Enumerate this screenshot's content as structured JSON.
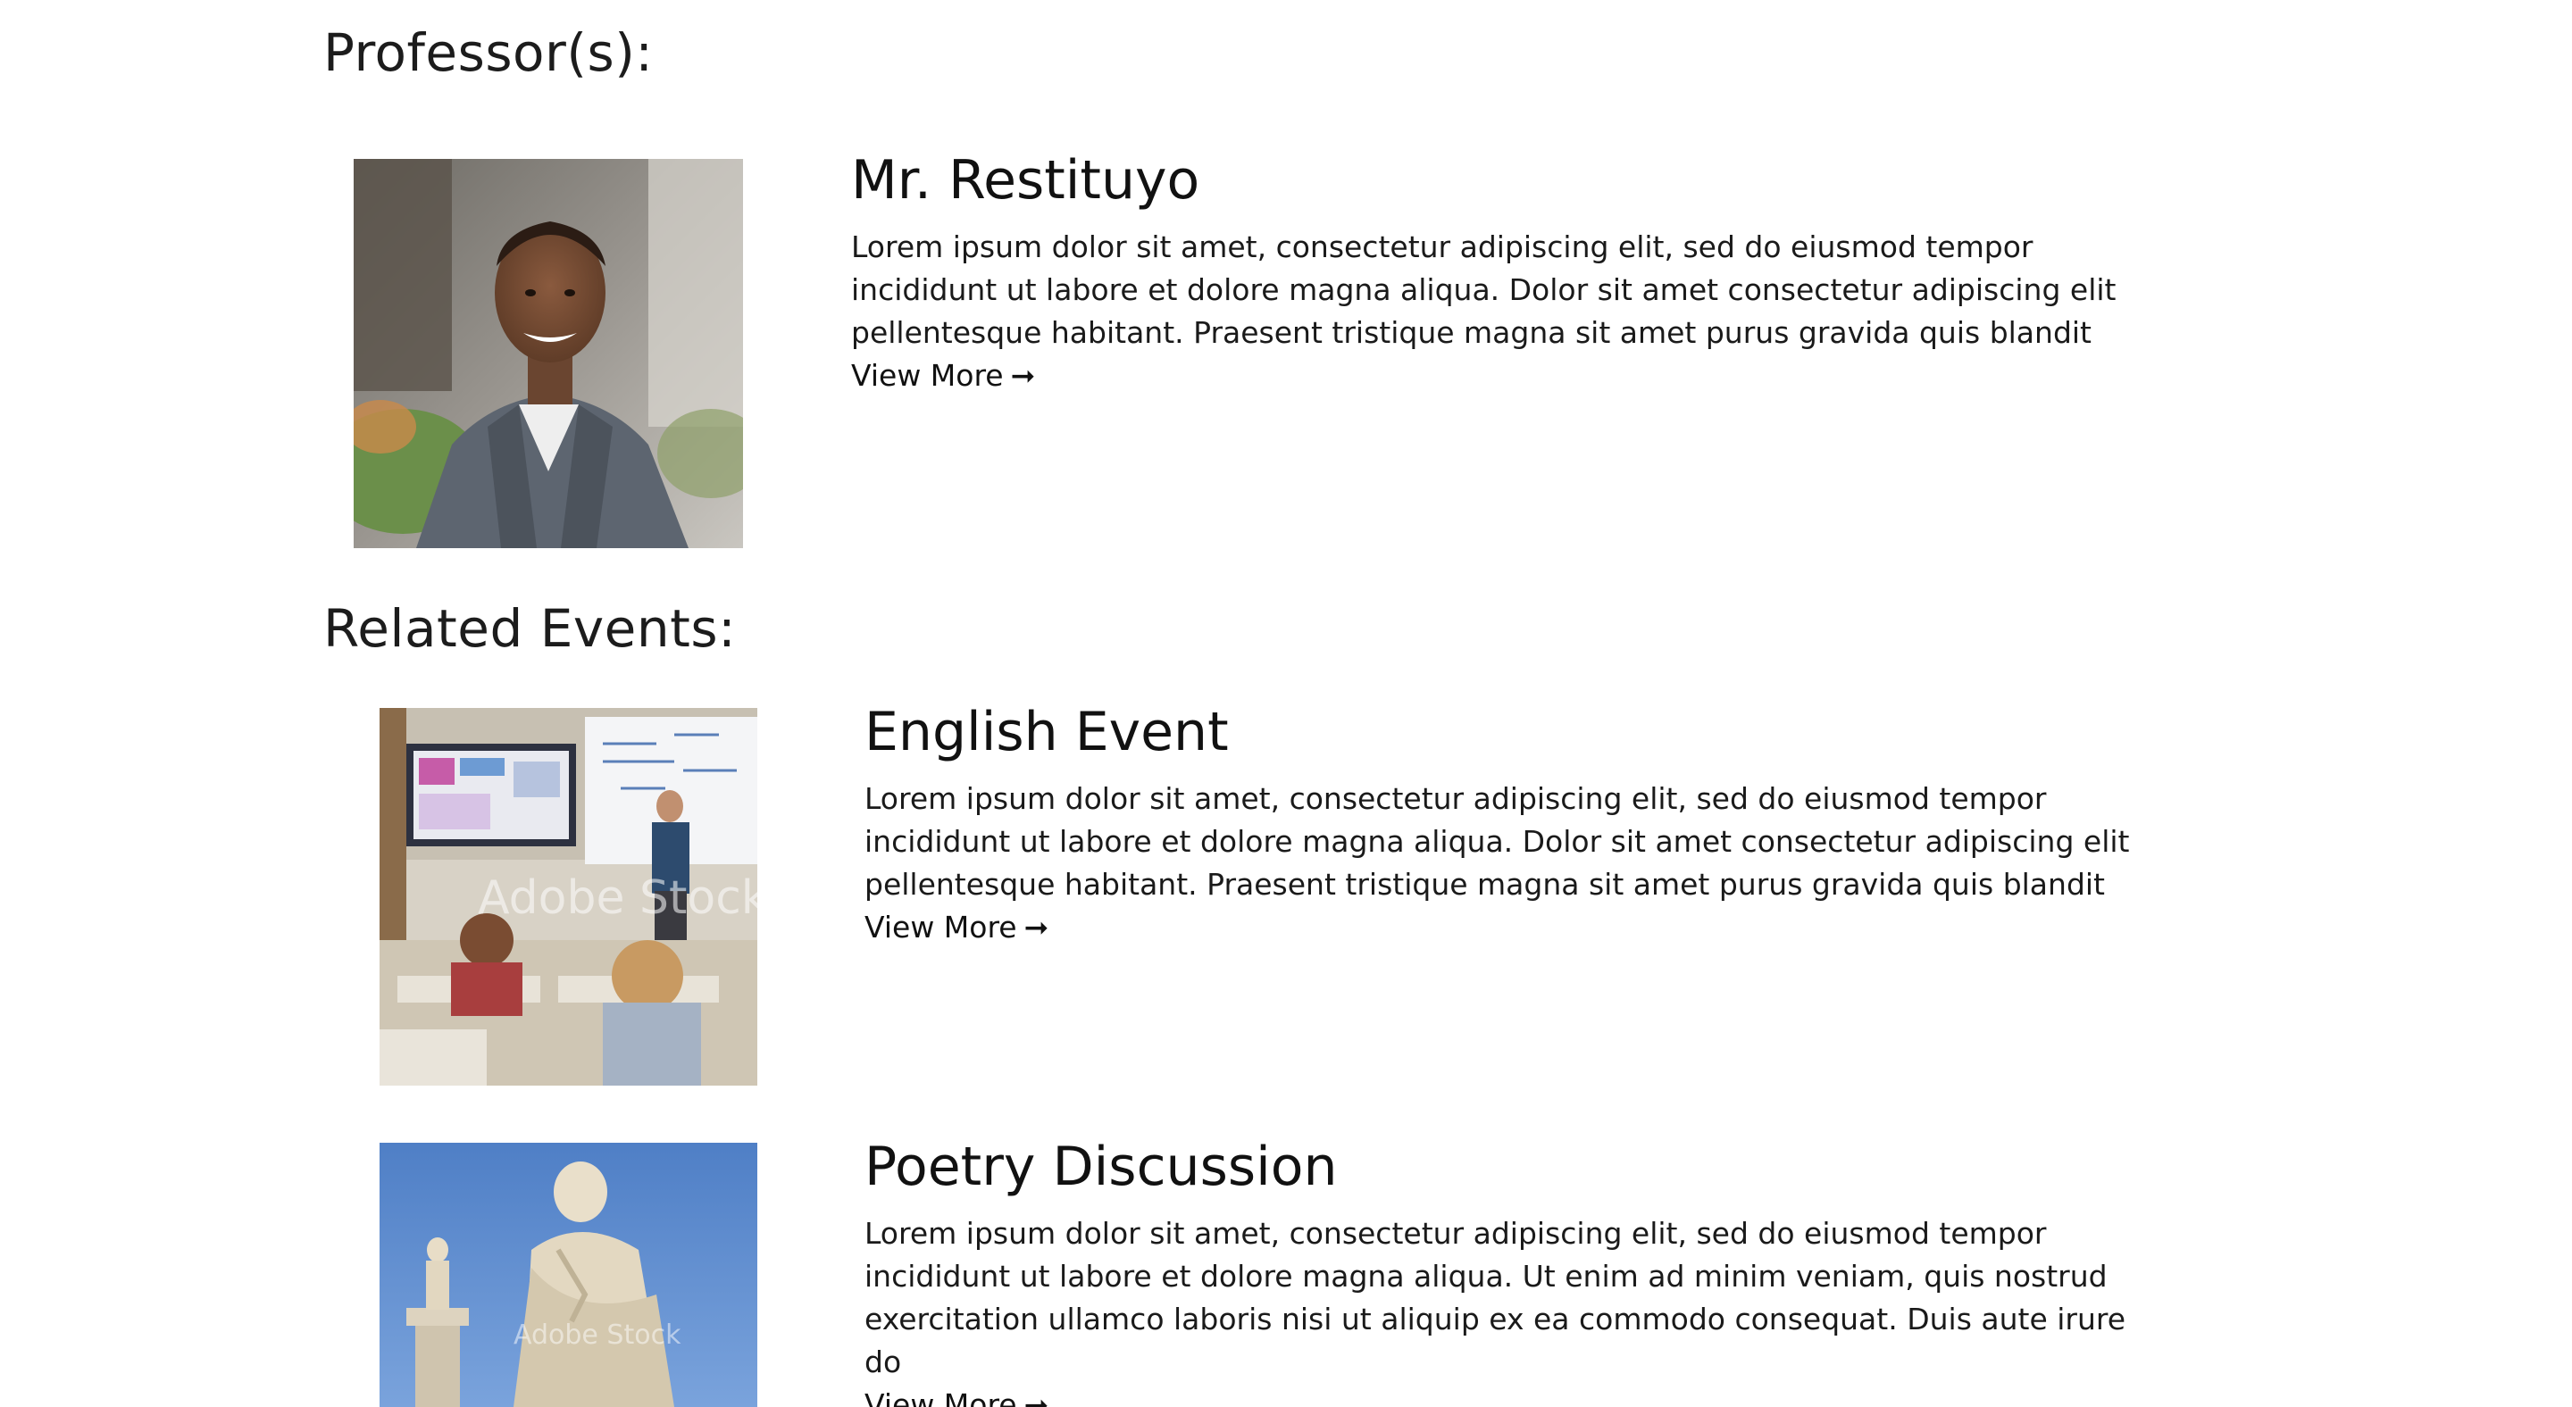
{
  "professors_section": {
    "heading": "Professor(s):",
    "items": [
      {
        "name": "Mr. Restituyo",
        "description": "Lorem ipsum dolor sit amet, consectetur adipiscing elit, sed do eiusmod tempor incididunt ut labore et dolore magna aliqua. Dolor sit amet consectetur adipiscing elit pellentesque habitant. Praesent tristique magna sit amet purus gravida quis blandit",
        "link_label": "View More",
        "link_icon": "arrow-right-icon"
      }
    ]
  },
  "events_section": {
    "heading": "Related Events:",
    "items": [
      {
        "title": "English Event",
        "description": "Lorem ipsum dolor sit amet, consectetur adipiscing elit, sed do eiusmod tempor incididunt ut labore et dolore magna aliqua. Dolor sit amet consectetur adipiscing elit pellentesque habitant. Praesent tristique magna sit amet purus gravida quis blandit",
        "link_label": "View More",
        "link_icon": "arrow-right-icon",
        "image_watermark": "Adobe Stock"
      },
      {
        "title": "Poetry Discussion",
        "description": "Lorem ipsum dolor sit amet, consectetur adipiscing elit, sed do eiusmod tempor incididunt ut labore et dolore magna aliqua. Ut enim ad minim veniam, quis nostrud exercitation ullamco laboris nisi ut aliquip ex ea commodo consequat. Duis aute irure do",
        "link_label": "View More",
        "link_icon": "arrow-right-icon",
        "image_watermark": "Adobe Stock"
      }
    ]
  }
}
